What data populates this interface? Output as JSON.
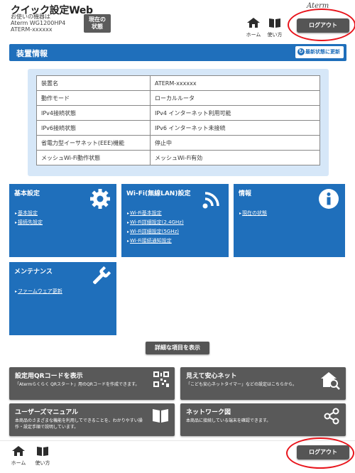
{
  "header": {
    "app_title": "クイック設定Web",
    "device_caption_1": "お使いの機器は",
    "device_caption_2": "Aterm WG1200HP4",
    "device_caption_3": "ATERM-xxxxxx",
    "status_button_1": "現在の",
    "status_button_2": "状態",
    "brand": "Aterm",
    "home_label": "ホーム",
    "howto_label": "使い方",
    "logout_label": "ログアウト"
  },
  "device_info": {
    "title": "装置情報",
    "refresh_label": "最新状態に更新",
    "rows": [
      {
        "key": "装置名",
        "value": "ATERM-xxxxxx"
      },
      {
        "key": "動作モード",
        "value": "ローカルルータ"
      },
      {
        "key": "IPv4接続状態",
        "value": "IPv4 インターネット利用可能"
      },
      {
        "key": "IPv6接続状態",
        "value": "IPv6 インターネット未接続"
      },
      {
        "key": "省電力型イーサネット(EEE)機能",
        "value": "停止中"
      },
      {
        "key": "メッシュWi-Fi動作状態",
        "value": "メッシュWi-Fi有効"
      }
    ]
  },
  "tiles": {
    "basic": {
      "title": "基本設定",
      "links": [
        "基本設定",
        "接続先設定"
      ]
    },
    "wifi": {
      "title": "Wi-Fi(無線LAN)設定",
      "links": [
        "Wi-Fi基本設定",
        "Wi-Fi詳細設定(2.4GHz)",
        "Wi-Fi詳細設定(5GHz)",
        "Wi-Fi接続通知設定"
      ]
    },
    "info": {
      "title": "情報",
      "links": [
        "現在の状態"
      ]
    },
    "maintenance": {
      "title": "メンテナンス",
      "links": [
        "ファームウェア更新"
      ]
    }
  },
  "detail_button": "詳細な項目を表示",
  "shortcuts": {
    "qr": {
      "title": "設定用QRコードを表示",
      "desc": "「Atermらくらく QRスタート」用のQRコードを作成できます。"
    },
    "mieru": {
      "title": "見えて安心ネット",
      "desc": "「こども安心ネットタイマー」などの設定はこちらから。"
    },
    "manual": {
      "title": "ユーザーズマニュアル",
      "desc1": "本商品のさまざまな機能を利用してできることを、わかりやすい操",
      "desc2": "作・設定手順で説明しています。"
    },
    "network": {
      "title": "ネットワーク図",
      "desc": "本商品に接続している端末を確認できます。"
    }
  },
  "footer": {
    "home_label": "ホーム",
    "howto_label": "使い方",
    "logout_label": "ログアウト"
  },
  "colors": {
    "primary_blue": "#1f6fbb",
    "panel_blue": "#d6e7f8",
    "dark_button": "#555555",
    "highlight_red": "#e8141b"
  },
  "icons": [
    "home-icon",
    "book-icon",
    "refresh-icon",
    "gear-icon",
    "wifi-icon",
    "info-icon",
    "wrench-icon",
    "qr-code-icon",
    "house-search-icon",
    "share-icon"
  ]
}
